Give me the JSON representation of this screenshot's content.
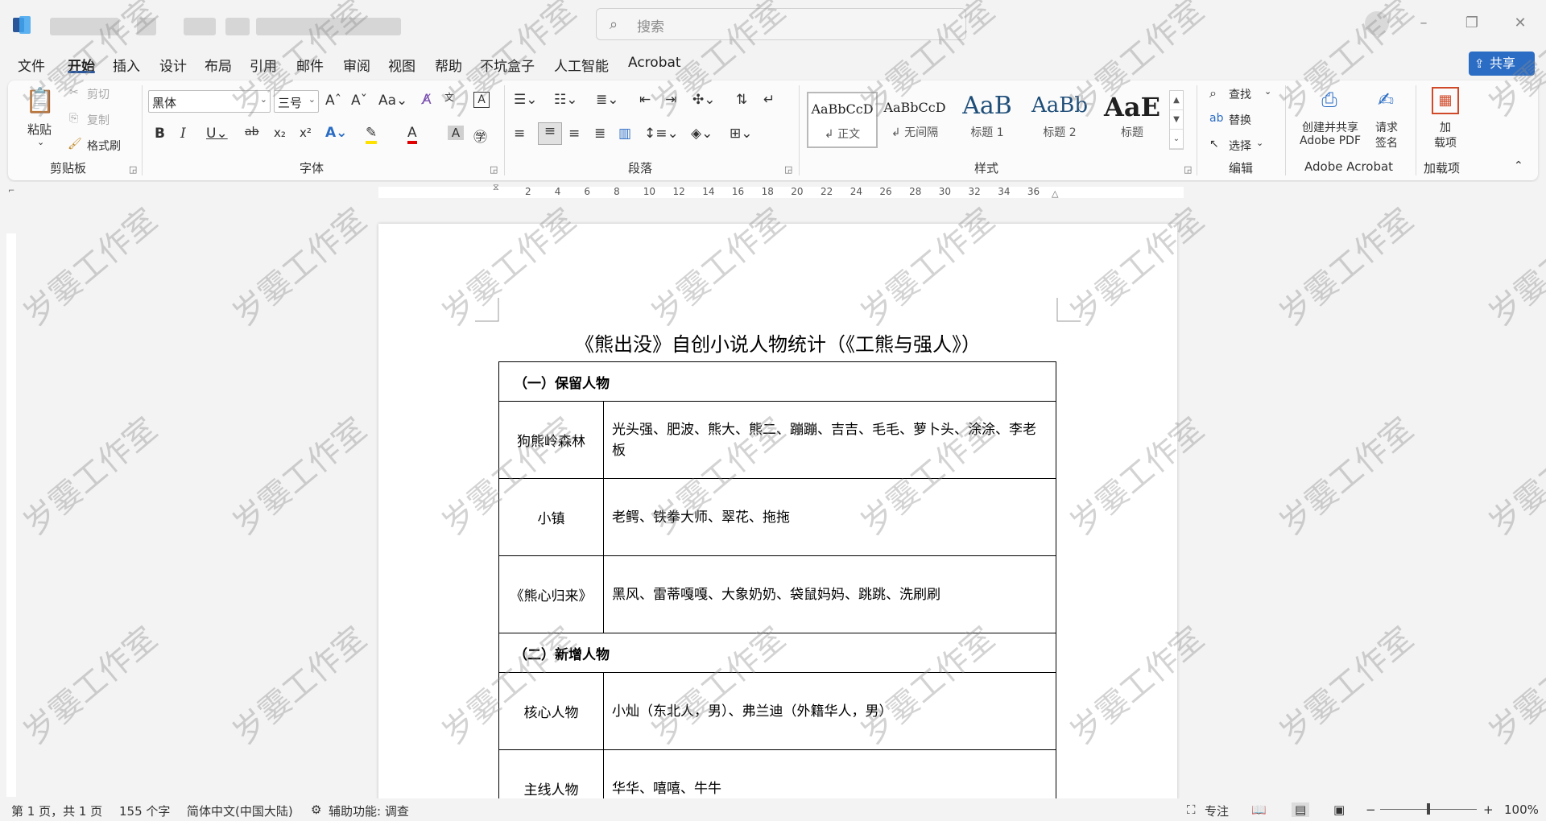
{
  "titlebar": {
    "search_placeholder": "搜索"
  },
  "menu": {
    "items": [
      "文件",
      "开始",
      "插入",
      "设计",
      "布局",
      "引用",
      "邮件",
      "审阅",
      "视图",
      "帮助",
      "不坑盒子",
      "人工智能",
      "Acrobat"
    ],
    "active": "开始",
    "share": "共享"
  },
  "ribbon": {
    "clipboard": {
      "paste": "粘贴",
      "cut": "剪切",
      "copy": "复制",
      "format_painter": "格式刷",
      "label": "剪贴板"
    },
    "font": {
      "name": "黑体",
      "size": "三号",
      "label": "字体"
    },
    "paragraph": {
      "label": "段落"
    },
    "styles": {
      "label": "样式",
      "items": [
        {
          "preview": "AaBbCcD",
          "name": "↲ 正文"
        },
        {
          "preview": "AaBbCcD",
          "name": "↲ 无间隔"
        },
        {
          "preview": "AaB",
          "name": "标题 1"
        },
        {
          "preview": "AaBb",
          "name": "标题 2"
        },
        {
          "preview": "AaE",
          "name": "标题"
        }
      ]
    },
    "editing": {
      "find": "查找",
      "replace": "替换",
      "select": "选择",
      "label": "编辑"
    },
    "acrobat": {
      "create_line1": "创建并共享",
      "create_line2": "Adobe PDF",
      "sign_line1": "请求",
      "sign_line2": "签名",
      "label": "Adobe Acrobat"
    },
    "addins": {
      "line1": "加",
      "line2": "载项",
      "label": "加载项"
    }
  },
  "ruler": {
    "numbers": [
      "2",
      "4",
      "6",
      "8",
      "10",
      "12",
      "14",
      "16",
      "18",
      "20",
      "22",
      "24",
      "26",
      "28",
      "30",
      "32",
      "34",
      "36"
    ]
  },
  "document": {
    "title": "《熊出没》自创小说人物统计（《工熊与强人》）",
    "sections": [
      {
        "heading": "（一）保留人物",
        "rows": [
          {
            "label": "狗熊岭森林",
            "value": "光头强、肥波、熊大、熊二、蹦蹦、吉吉、毛毛、萝卜头、涂涂、李老板"
          },
          {
            "label": "小镇",
            "value": "老鳄、铁拳大师、翠花、拖拖"
          },
          {
            "label": "《熊心归来》",
            "value": "黑风、雷蒂嘎嘎、大象奶奶、袋鼠妈妈、跳跳、洗刷刷"
          }
        ]
      },
      {
        "heading": "（二）新增人物",
        "rows": [
          {
            "label": "核心人物",
            "value": "小灿（东北人，男）、弗兰迪（外籍华人，男）"
          },
          {
            "label": "主线人物",
            "value": "华华、嘻嘻、牛牛"
          }
        ]
      }
    ]
  },
  "statusbar": {
    "page": "第 1 页，共 1 页",
    "words": "155 个字",
    "language": "简体中文(中国大陆)",
    "accessibility": "辅助功能: 调查",
    "focus": "专注",
    "zoom": "100%"
  },
  "watermark": {
    "text": "岁霎工作室"
  },
  "colors": {
    "accent": "#2b579a",
    "share": "#2b6cc4"
  }
}
